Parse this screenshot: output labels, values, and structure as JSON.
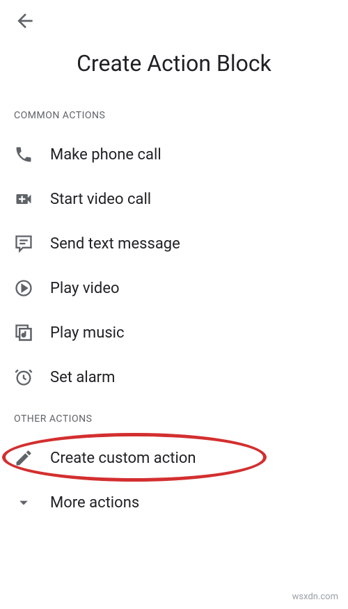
{
  "header": {
    "title": "Create Action Block"
  },
  "sections": {
    "common_label": "COMMON ACTIONS",
    "other_label": "OTHER ACTIONS"
  },
  "actions": {
    "phone": "Make phone call",
    "video_call": "Start video call",
    "text": "Send text message",
    "play_video": "Play video",
    "music": "Play music",
    "alarm": "Set alarm",
    "custom": "Create custom action",
    "more": "More actions"
  },
  "attribution": "wsxdn.com"
}
